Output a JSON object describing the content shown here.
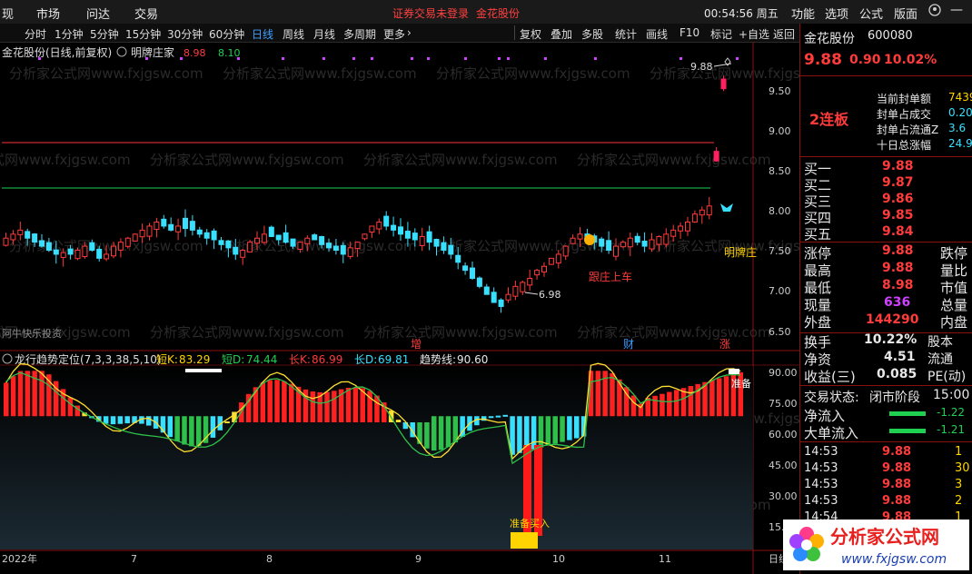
{
  "menu": {
    "items": [
      "现",
      "市场",
      "问达",
      "交易"
    ],
    "notice": "证券交易未登录",
    "stock_link": "金花股份",
    "clock": "00:54:56 周五",
    "right_items": [
      "功能",
      "选项",
      "公式",
      "版面"
    ]
  },
  "toolbar": {
    "timeframes": [
      "分时",
      "1分钟",
      "5分钟",
      "15分钟",
      "30分钟",
      "60分钟",
      "日线",
      "周线",
      "月线",
      "多周期",
      "更多"
    ],
    "active_timeframe": "日线",
    "right_buttons": [
      "复权",
      "叠加",
      "多股",
      "统计",
      "画线",
      "F10",
      "标记",
      "+自选",
      "返回"
    ]
  },
  "main_chart": {
    "title": "金花股份(日线,前复权)",
    "indicator_name": "明牌庄家",
    "indicator_values": [
      "8.98",
      "8.10"
    ],
    "y_ticks": [
      "9.50",
      "9.00",
      "8.50",
      "8.00",
      "7.50",
      "7.00",
      "6.50"
    ],
    "high_label": "9.88",
    "low_label": "6.98",
    "annotation_follow": "跟庄上车",
    "annotation_mingpai": "明牌庄",
    "source_label": "阿牛快乐投资",
    "event_tags": [
      "增",
      "财",
      "涨"
    ],
    "watermark": "分析家公式网www.fxjgsw.com"
  },
  "sub_chart": {
    "name": "龙行趋势定位(7,3,3,38,5,10)",
    "params": [
      {
        "label": "短K:",
        "value": "83.29",
        "color": "#ffd400"
      },
      {
        "label": "短D:",
        "value": "74.44",
        "color": "#20d050"
      },
      {
        "label": "长K:",
        "value": "86.99",
        "color": "#ff3b3b"
      },
      {
        "label": "长D:",
        "value": "69.81",
        "color": "#38e0ff"
      },
      {
        "label": "趋势线:",
        "value": "90.60",
        "color": "#e8e8e8"
      }
    ],
    "y_ticks": [
      "90.00",
      "75.00",
      "60.00",
      "45.00",
      "30.00",
      "15.00"
    ],
    "buy_label": "准备买入",
    "prep_label": "准备"
  },
  "x_axis": {
    "labels": [
      "2022年",
      "7",
      "8",
      "9",
      "10",
      "11",
      "日线"
    ]
  },
  "right_panel": {
    "name": "金花股份",
    "code": "600080",
    "price": "9.88",
    "change": "0.90",
    "change_pct": "10.02%",
    "streak": "2连板",
    "seal_rows": [
      {
        "label": "当前封单额",
        "value": "7439"
      },
      {
        "label": "封单占成交",
        "value": "0.20"
      },
      {
        "label": "封单占流通Z",
        "value": "3.6"
      },
      {
        "label": "十日总涨幅",
        "value": "24.9"
      }
    ],
    "bids": [
      {
        "label": "买一",
        "price": "9.88"
      },
      {
        "label": "买二",
        "price": "9.87"
      },
      {
        "label": "买三",
        "price": "9.86"
      },
      {
        "label": "买四",
        "price": "9.85"
      },
      {
        "label": "买五",
        "price": "9.84"
      }
    ],
    "quote": [
      {
        "l1": "涨停",
        "v1": "9.88",
        "l2": "跌停"
      },
      {
        "l1": "最高",
        "v1": "9.88",
        "l2": "量比"
      },
      {
        "l1": "最低",
        "v1": "8.98",
        "l2": "市值"
      },
      {
        "l1": "现量",
        "v1": "636",
        "l2": "总量"
      },
      {
        "l1": "外盘",
        "v1": "144290",
        "l2": "内盘"
      }
    ],
    "fund": [
      {
        "l1": "换手",
        "v1": "10.22%",
        "l2": "股本"
      },
      {
        "l1": "净资",
        "v1": "4.51",
        "l2": "流通"
      },
      {
        "l1": "收益(三)",
        "v1": "0.085",
        "l2": "PE(动)"
      }
    ],
    "status_label": "交易状态:",
    "status_value": "闭市阶段",
    "status_time": "15:00",
    "flows": [
      {
        "label": "净流入",
        "value": "-1.22"
      },
      {
        "label": "大单流入",
        "value": "-1.21"
      }
    ],
    "ticks": [
      {
        "time": "14:53",
        "price": "9.88",
        "vol": "1"
      },
      {
        "time": "14:53",
        "price": "9.88",
        "vol": "30"
      },
      {
        "time": "14:53",
        "price": "9.88",
        "vol": "3"
      },
      {
        "time": "14:53",
        "price": "9.88",
        "vol": "2"
      },
      {
        "time": "14:54",
        "price": "9.88",
        "vol": "1"
      }
    ]
  },
  "brand": {
    "name": "分析家公式网",
    "url": "www.fxjgsw.com"
  },
  "colors": {
    "up": "#ff3b3b",
    "down": "#38e0ff",
    "bg": "#000000",
    "accent": "#ffd400"
  }
}
